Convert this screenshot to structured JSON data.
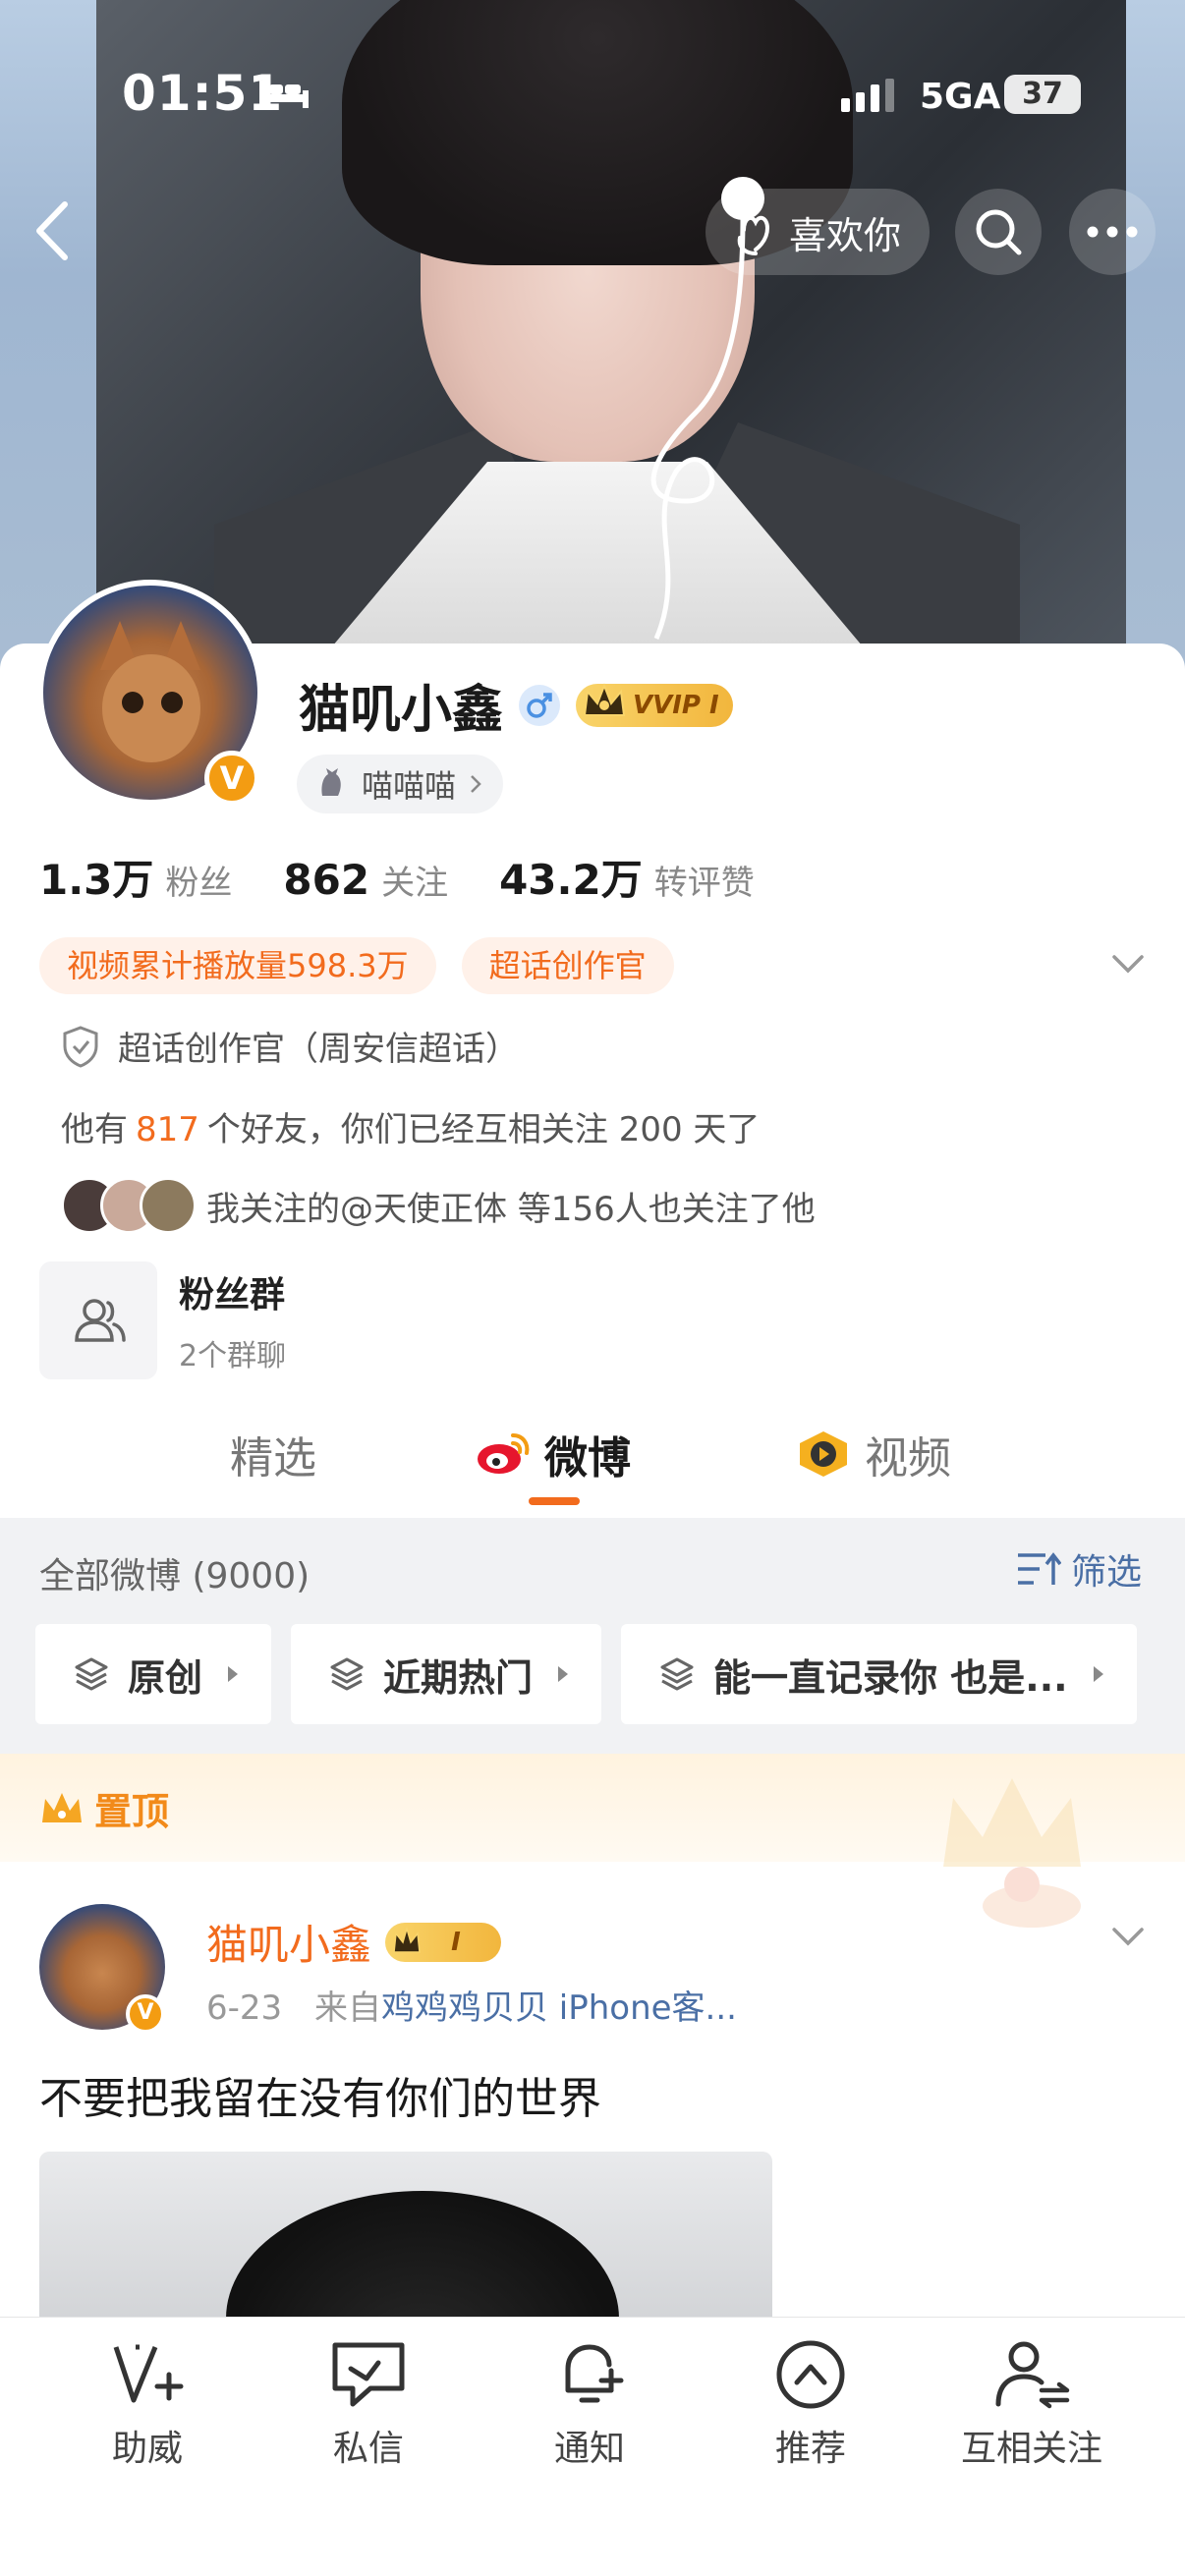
{
  "status_bar": {
    "time": "01:51",
    "network": "5GA",
    "battery": "37"
  },
  "top_nav": {
    "like_label": "喜欢你"
  },
  "profile": {
    "name": "猫叽小鑫",
    "vip_label": "VVIP I",
    "tag": "喵喵喵",
    "stats": [
      {
        "num": "1.3万",
        "label": "粉丝"
      },
      {
        "num": "862",
        "label": "关注"
      },
      {
        "num": "43.2万",
        "label": "转评赞"
      }
    ],
    "pills": [
      "视频累计播放量598.3万",
      "超话创作官"
    ],
    "certification": "超话创作官（周安信超话）",
    "friends": {
      "prefix": "他有",
      "count": "817",
      "suffix": "个好友，你们已经互相关注 200 天了"
    },
    "mutual_follow": "我关注的@天使正体  等156人也关注了他",
    "fan_group": {
      "title": "粉丝群",
      "subtitle": "2个群聊"
    }
  },
  "tabs": [
    {
      "label": "精选",
      "active": false
    },
    {
      "label": "微博",
      "active": true
    },
    {
      "label": "视频",
      "active": false
    }
  ],
  "filter": {
    "count_label": "全部微博 (9000)",
    "filter_label": "筛选",
    "chips": [
      "原创",
      "近期热门",
      "能一直记录你 也是..."
    ]
  },
  "pinned": {
    "label": "置顶"
  },
  "post": {
    "author": "猫叽小鑫",
    "vip_label": "I",
    "date": "6-23",
    "source_prefix": "来自",
    "source": "鸡鸡鸡贝贝 iPhone客...",
    "text": "不要把我留在没有你们的世界"
  },
  "bottom_bar": [
    {
      "label": "助威",
      "icon": "v-plus-icon"
    },
    {
      "label": "私信",
      "icon": "message-icon"
    },
    {
      "label": "通知",
      "icon": "bell-icon"
    },
    {
      "label": "推荐",
      "icon": "chevron-up-circle-icon"
    },
    {
      "label": "互相关注",
      "icon": "mutual-follow-icon"
    }
  ],
  "colors": {
    "accent": "#f26b1d",
    "link": "#4a6fa5",
    "vip_gold": "#f2b63d",
    "filter_bg": "#f1f2f4"
  }
}
